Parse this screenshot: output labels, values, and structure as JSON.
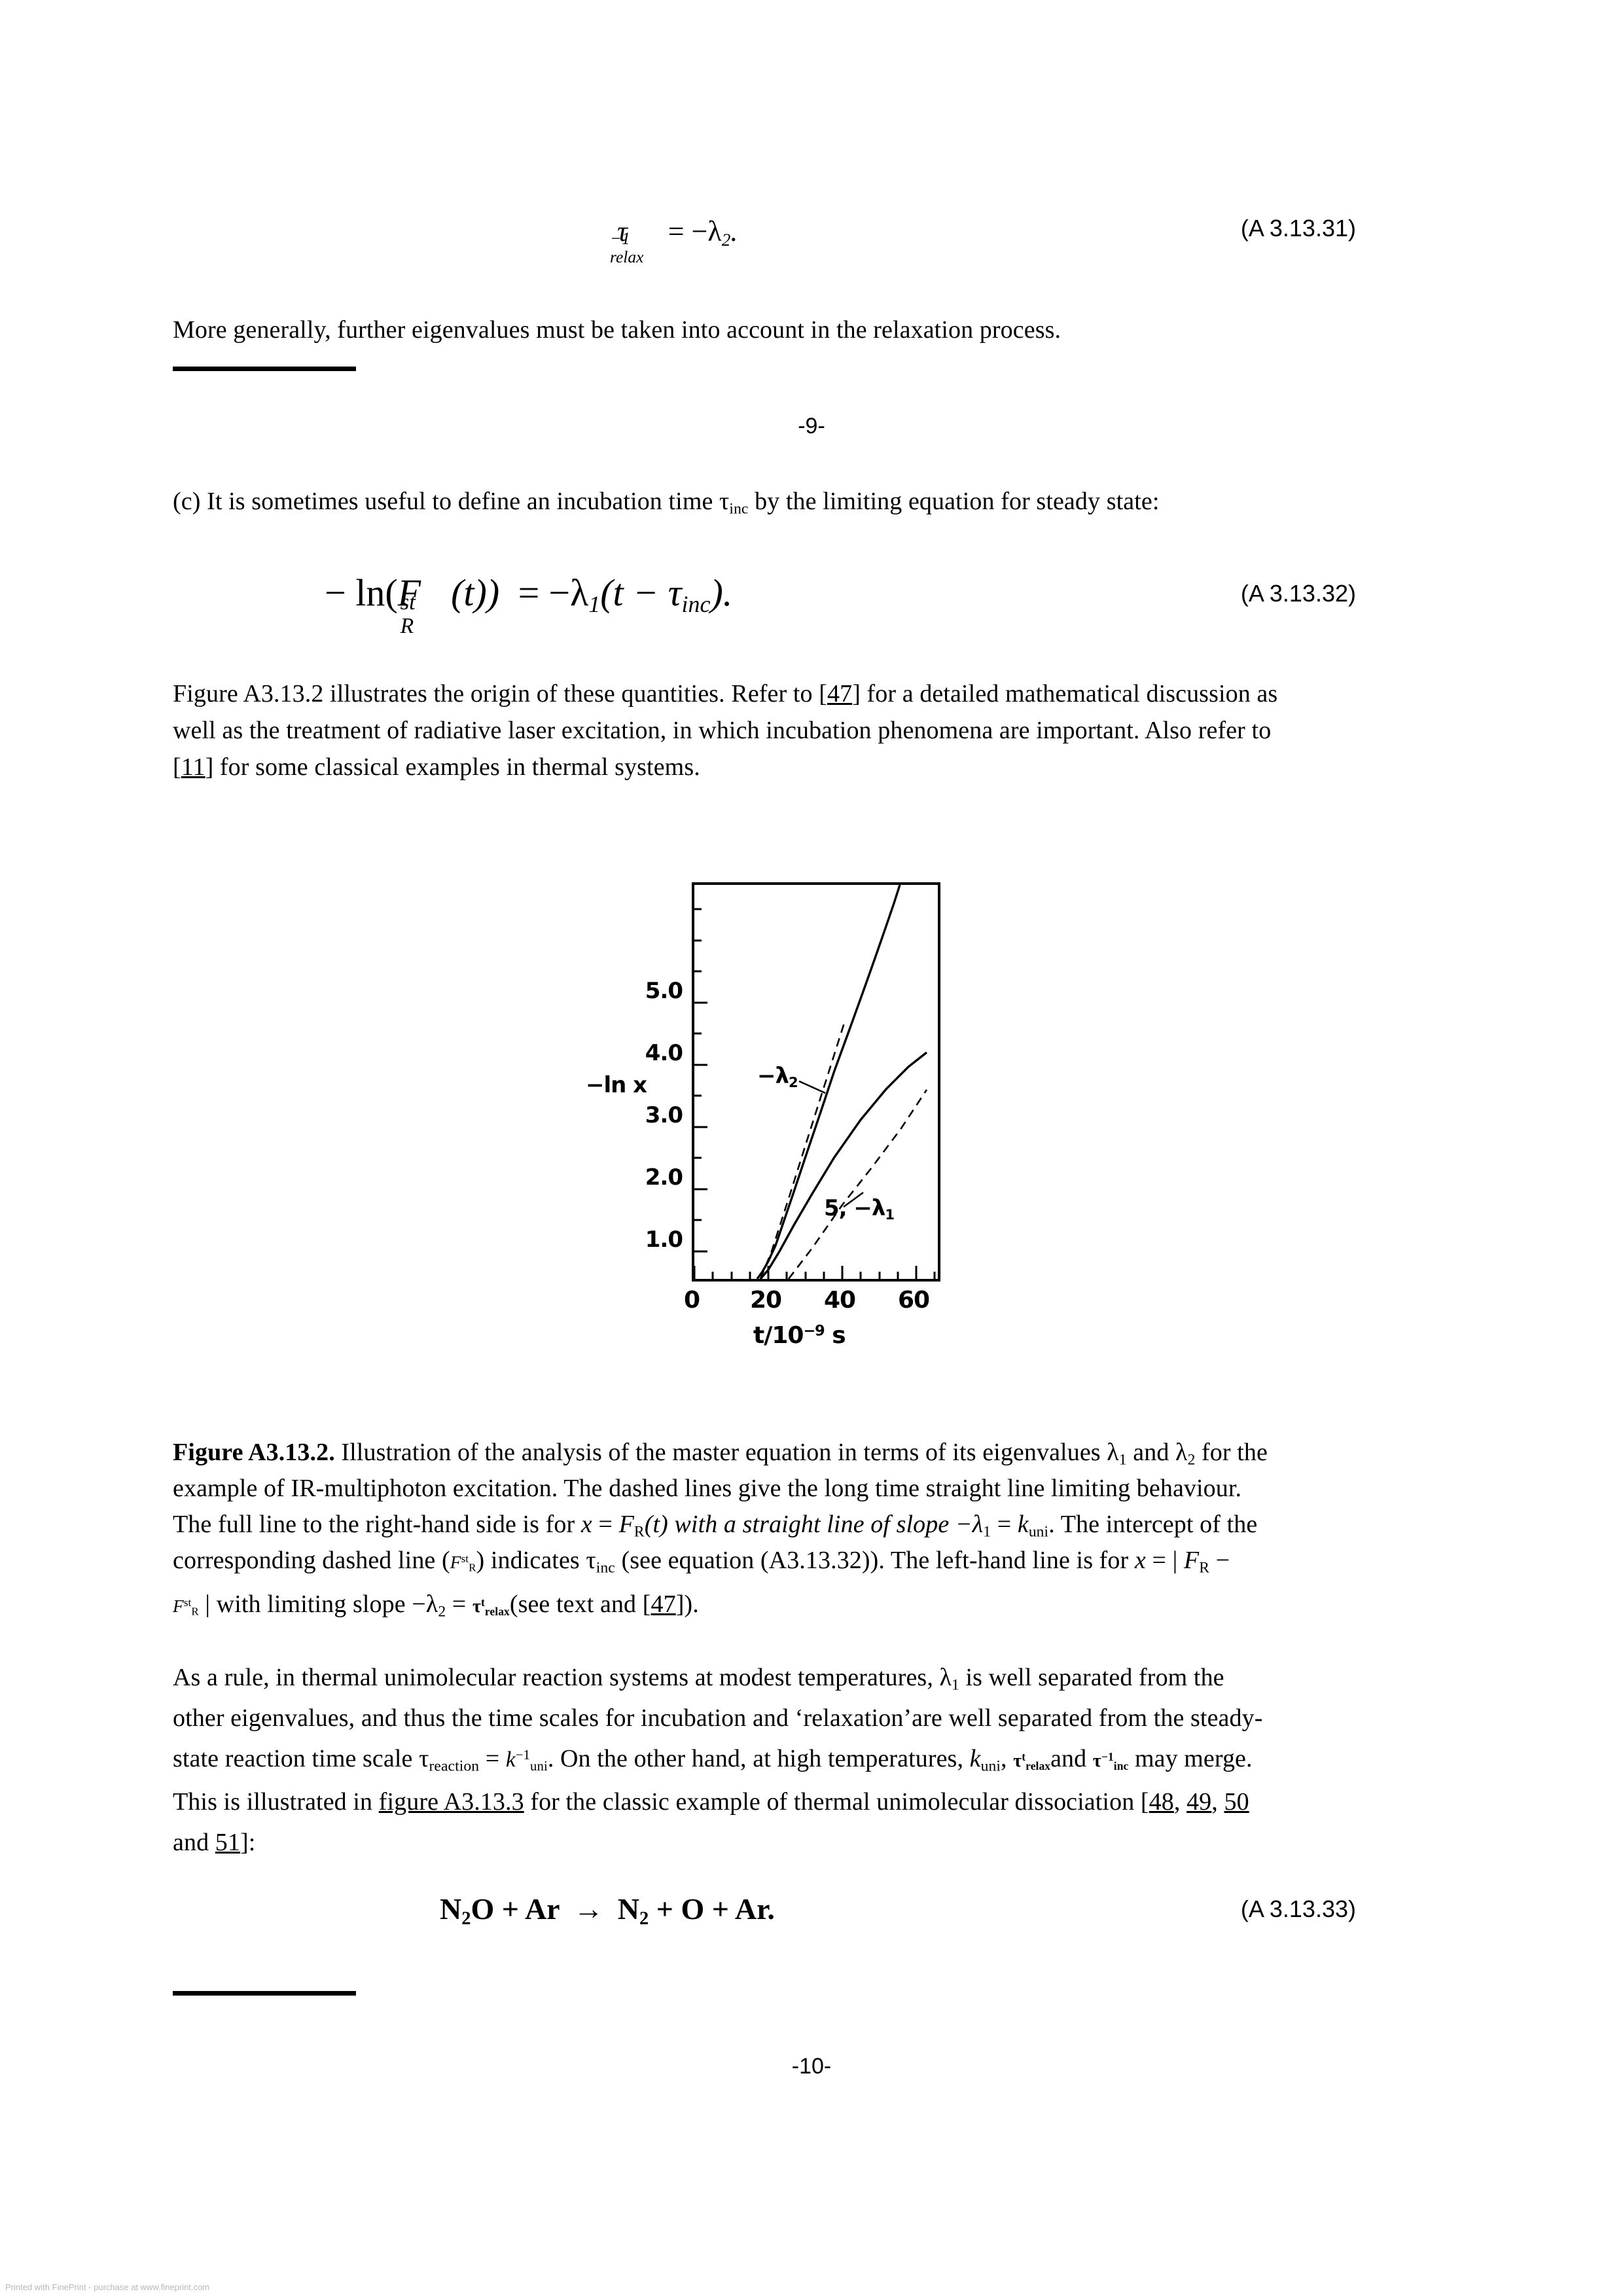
{
  "document": {
    "page_folio_top": "-9-",
    "page_folio_bottom": "-10-",
    "watermark": "Printed with FinePrint - purchase at www.fineprint.com"
  },
  "equations": {
    "eq_31": {
      "number": "(A 3.13.31)",
      "tau": "τ",
      "sup": "−1",
      "sub": "relax",
      "rhs": "= −λ",
      "rhs_sub": "2",
      "tail": "."
    },
    "eq_32": {
      "number": "(A 3.13.32)",
      "lhs_open": "− ln(",
      "f_symbol": "F",
      "f_sup": "st",
      "f_sub": "R",
      "arg": "(t))",
      "eq_sign": "=",
      "rhs_minus": "−λ",
      "rhs_sub": "1",
      "rhs_paren_open": "(t − τ",
      "rhs_tau_sub": "inc",
      "rhs_paren_close": ")."
    },
    "eq_33": {
      "number": "(A 3.13.33)",
      "reactant_1": "N",
      "reactant_1_sub": "2",
      "reactant_1_tail": "O",
      "plus_1": "+ Ar",
      "arrow": "→",
      "product_1": "N",
      "product_1_sub": "2",
      "product_rest": "+ O + Ar."
    }
  },
  "paragraphs": {
    "p_more_generally": "More generally, further eigenvalues must be taken into account in the relaxation process.",
    "p_c_lead": "(c) It is sometimes useful to define an incubation time τ",
    "p_c_sub": "inc",
    "p_c_tail": " by the limiting equation for steady state:",
    "p_figure_ref_l1_a": "Figure A3.13.2 illustrates the origin of these quantities. Refer to [",
    "p_figure_ref_l1_link": "47",
    "p_figure_ref_l1_b": "] for a detailed mathematical discussion as",
    "p_figure_ref_l2": "well as the treatment of radiative laser excitation, in which incubation phenomena are important. Also refer to",
    "p_figure_ref_l3_a": "[",
    "p_figure_ref_l3_link": "11",
    "p_figure_ref_l3_b": "] for some classical examples in thermal systems."
  },
  "caption": {
    "label": "Figure A3.13.2.",
    "l1_a": " Illustration of the analysis of the master equation in terms of its eigenvalues λ",
    "l1_sub1": "1",
    "l1_b": " and λ",
    "l1_sub2": "2",
    "l1_c": " for the",
    "l2": "example of IR-multiphoton excitation. The dashed lines give the long time straight line limiting behaviour.",
    "l3_a": "The full line to the right-hand side is for ",
    "l3_x": "x",
    "l3_b": " = ",
    "l3_f": "F",
    "l3_f_sub": "R",
    "l3_c": "(t) with a straight line of slope −λ",
    "l3_lam_sub": "1",
    "l3_d": " = ",
    "l3_k": "k",
    "l3_k_sub": "uni",
    "l3_e": ". The intercept of the",
    "l4_a": "corresponding dashed line (",
    "l4_f": "F",
    "l4_f_sup": "st",
    "l4_f_sub": "R",
    "l4_b": ") indicates τ",
    "l4_tau_sub": "inc",
    "l4_c": " (see equation (A3.13.32)). The left-hand line is for ",
    "l4_x": "x",
    "l4_d": " = | ",
    "l4_fr": "F",
    "l4_fr_sub": "R",
    "l4_e": " −",
    "l5_f": "F",
    "l5_f_sup": "st",
    "l5_f_sub": "R",
    "l5_a": " | with limiting slope −λ",
    "l5_sub": "2",
    "l5_b": " = ",
    "l5_tau": "τ",
    "l5_tau_sup": "t",
    "l5_tau_sub": "relax",
    "l5_c": "(see text and [",
    "l5_link": "47",
    "l5_d": "])."
  },
  "closing": {
    "l1_a": "As a rule, in thermal unimolecular reaction systems at modest temperatures, λ",
    "l1_sub": "1",
    "l1_b": " is well separated from the",
    "l2": "other eigenvalues, and thus the time scales for incubation and ‘relaxation’are well separated from the steady-",
    "l3_a": "state reaction time scale τ",
    "l3_tau_sub": "reaction",
    "l3_b": " = ",
    "l3_k": "k",
    "l3_k_sup": "−1",
    "l3_k_sub": "uni",
    "l3_c": ". On the other hand, at high temperatures, ",
    "l3_kuni": "k",
    "l3_kuni_sub": "uni",
    "l3_d": ", ",
    "l3_tau2": "τ",
    "l3_tau2_sup": "t",
    "l3_tau2_sub": "relax",
    "l3_e": "and ",
    "l3_tau3": "τ",
    "l3_tau3_sup": "−1",
    "l3_tau3_sub": "inc",
    "l3_f": " may merge.",
    "l4_a": "This is illustrated in ",
    "l4_link": "figure A3.13.3",
    "l4_b": " for the classic example of thermal unimolecular dissociation [",
    "l4_ref1": "48",
    "l4_sep1": ", ",
    "l4_ref2": "49",
    "l4_sep2": ", ",
    "l4_ref3": "50",
    "l5_a": "and ",
    "l5_ref": "51",
    "l5_b": "]:"
  },
  "chart_data": {
    "type": "line",
    "title": "",
    "xlabel": "t/10⁻⁹ s",
    "ylabel": "−ln x",
    "xlim": [
      0,
      66
    ],
    "ylim": [
      0,
      5.9
    ],
    "xticks": [
      0,
      20,
      40,
      60
    ],
    "xtick_labels": [
      "0",
      "20",
      "40",
      "60"
    ],
    "yticks": [
      1.0,
      2.0,
      3.0,
      4.0,
      5.0
    ],
    "ytick_labels": [
      "1.0",
      "2.0",
      "3.0",
      "4.0",
      "5.0"
    ],
    "grid": false,
    "legend": "none",
    "annotations": [
      {
        "text": "−λ",
        "sub": "2",
        "x": 27,
        "y": 4.35
      },
      {
        "text": "5, −λ",
        "sub": "1",
        "x": 43,
        "y": 0.85
      }
    ],
    "series": [
      {
        "name": "left full line (|F_R - F_R^st|), slope -lambda_2",
        "style": "solid",
        "x": [
          17.0,
          18.5,
          20.0,
          22.0,
          24.0,
          27.0,
          30.0,
          34.0,
          38.0,
          42.0,
          46.0,
          49.0
        ],
        "y": [
          0.0,
          0.08,
          0.3,
          0.72,
          1.18,
          1.9,
          2.62,
          3.6,
          4.55,
          5.45,
          5.9,
          5.9
        ]
      },
      {
        "name": "left dashed limiting line, slope -lambda_2",
        "style": "dashed",
        "x": [
          18.0,
          22.0,
          26.0
        ],
        "y": [
          0.0,
          0.95,
          1.92
        ]
      },
      {
        "name": "right full line (F_R(t)), slope -lambda_1 = k_uni",
        "style": "solid",
        "x": [
          18.0,
          20.0,
          23.0,
          27.0,
          32.0,
          38.0,
          45.0,
          52.0,
          58.0,
          63.0
        ],
        "y": [
          0.0,
          0.15,
          0.45,
          0.85,
          1.35,
          1.95,
          2.55,
          3.05,
          3.4,
          3.62
        ]
      },
      {
        "name": "right dashed limiting line (F_R^st), intercept tau_inc",
        "style": "dashed",
        "x": [
          25.5,
          32.0,
          40.0,
          48.0,
          56.0,
          63.0
        ],
        "y": [
          0.0,
          0.5,
          1.2,
          1.8,
          2.45,
          3.05
        ]
      }
    ]
  }
}
